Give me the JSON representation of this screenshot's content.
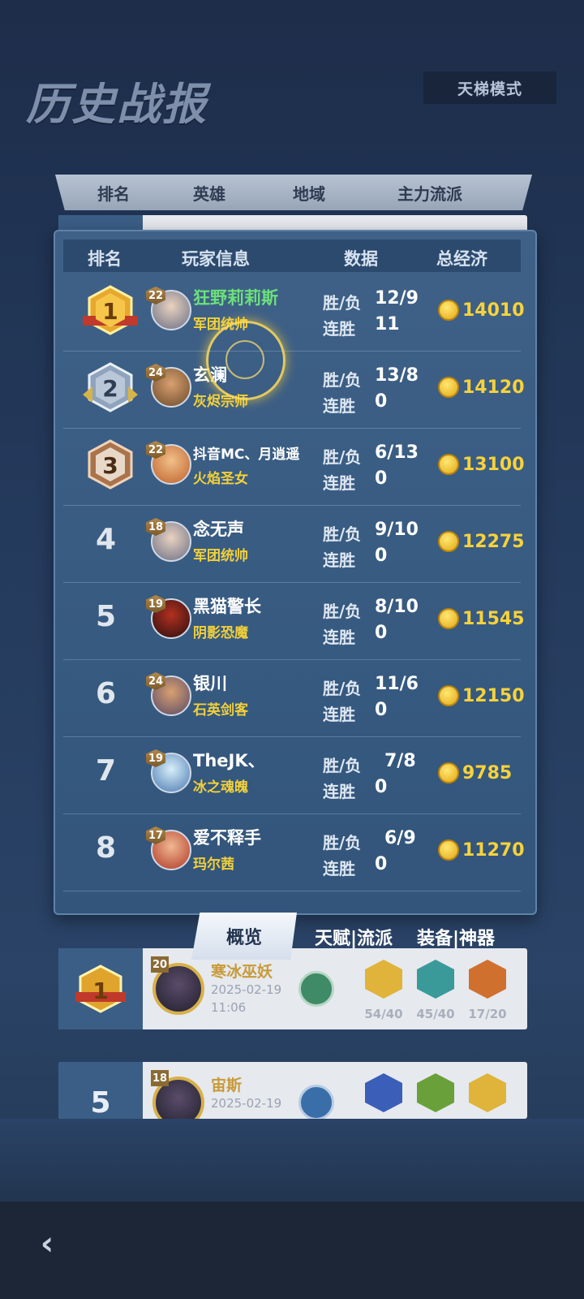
{
  "page_title": "历史战报",
  "mode_label": "天梯模式",
  "history_header": [
    "排名",
    "英雄",
    "地域",
    "主力流派"
  ],
  "panel_header": {
    "rank": "排名",
    "player": "玩家信息",
    "data": "数据",
    "economy": "总经济"
  },
  "labels": {
    "win_loss": "胜/负",
    "streak": "连胜"
  },
  "players": [
    {
      "rank": "1",
      "level": "22",
      "name": "狂野莉莉斯",
      "hero": "军团统帅",
      "wl": "12/9",
      "streak": "11",
      "gold": "14010"
    },
    {
      "rank": "2",
      "level": "24",
      "name": "玄澜",
      "hero": "灰烬宗师",
      "wl": "13/8",
      "streak": "0",
      "gold": "14120"
    },
    {
      "rank": "3",
      "level": "22",
      "name": "抖音MC、月逍遥",
      "hero": "火焰圣女",
      "wl": "6/13",
      "streak": "0",
      "gold": "13100"
    },
    {
      "rank": "4",
      "level": "18",
      "name": "念无声",
      "hero": "军团统帅",
      "wl": "9/10",
      "streak": "0",
      "gold": "12275"
    },
    {
      "rank": "5",
      "level": "19",
      "name": "黑猫警长",
      "hero": "阴影恐魔",
      "wl": "8/10",
      "streak": "0",
      "gold": "11545"
    },
    {
      "rank": "6",
      "level": "24",
      "name": "银川",
      "hero": "石英剑客",
      "wl": "11/6",
      "streak": "0",
      "gold": "12150"
    },
    {
      "rank": "7",
      "level": "19",
      "name": "TheJK、",
      "hero": "冰之魂魄",
      "wl": "7/8",
      "streak": "0",
      "gold": "9785"
    },
    {
      "rank": "8",
      "level": "17",
      "name": "爱不释手",
      "hero": "玛尔茜",
      "wl": "6/9",
      "streak": "0",
      "gold": "11270"
    }
  ],
  "tabs": {
    "overview": "概览",
    "talent": "天赋|流派",
    "equipment": "装备|神器"
  },
  "history": [
    {
      "rank": "1",
      "level": "20",
      "hero": "寒冰巫妖",
      "date": "2025-02-19",
      "time": "11:06",
      "stats": [
        "54/40",
        "45/40",
        "17/20"
      ]
    },
    {
      "rank": "5",
      "level": "18",
      "hero": "宙斯",
      "date": "2025-02-19"
    }
  ],
  "colors": {
    "panel": "#3f6188",
    "gold": "#f7d23a",
    "me": "#6ce07a",
    "hero": "#f2d03a"
  }
}
